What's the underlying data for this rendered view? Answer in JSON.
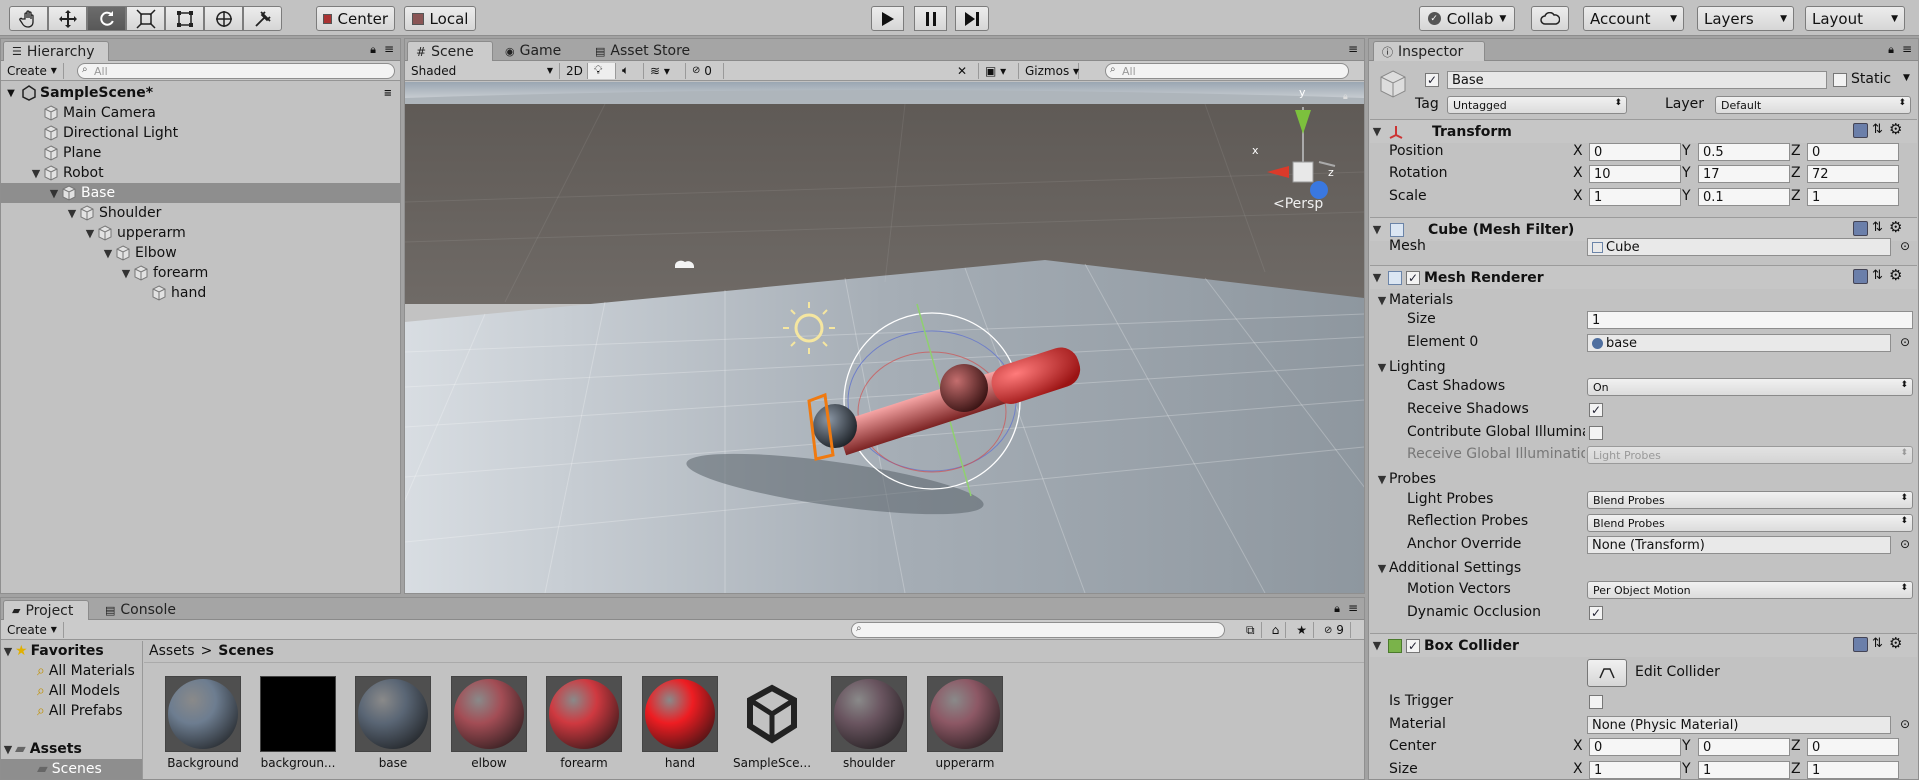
{
  "toolbar": {
    "center_label": "Center",
    "local_label": "Local",
    "collab_label": "Collab",
    "account_label": "Account",
    "layers_label": "Layers",
    "layout_label": "Layout"
  },
  "hierarchy": {
    "tab": "Hierarchy",
    "create": "Create",
    "search_placeholder": "All",
    "scene": "SampleScene*",
    "items": [
      "Main Camera",
      "Directional Light",
      "Plane",
      "Robot",
      "Base",
      "Shoulder",
      "upperarm",
      "Elbow",
      "forearm",
      "hand"
    ]
  },
  "scene": {
    "tabs": [
      "Scene",
      "Game",
      "Asset Store"
    ],
    "shading": "Shaded",
    "mode_2d": "2D",
    "hidden_count": "0",
    "gizmos": "Gizmos",
    "search_placeholder": "All",
    "persp": "Persp",
    "axis_x": "x",
    "axis_y": "y",
    "axis_z": "z"
  },
  "project": {
    "tabs": [
      "Project",
      "Console"
    ],
    "create": "Create",
    "favorites": "Favorites",
    "fav_items": [
      "All Materials",
      "All Models",
      "All Prefabs"
    ],
    "assets": "Assets",
    "scenes": "Scenes",
    "breadcrumb_root": "Assets",
    "breadcrumb_sep": ">",
    "breadcrumb_current": "Scenes",
    "visible_count": "9",
    "items": [
      {
        "name": "Background",
        "color": "#6d7d90"
      },
      {
        "name": "backgroun...",
        "color": "#000000"
      },
      {
        "name": "base",
        "color": "#5a6675"
      },
      {
        "name": "elbow",
        "color": "#a34d55"
      },
      {
        "name": "forearm",
        "color": "#cf3940"
      },
      {
        "name": "hand",
        "color": "#ee1d22"
      },
      {
        "name": "SampleSce...",
        "color": "unity"
      },
      {
        "name": "shoulder",
        "color": "#6a5560"
      },
      {
        "name": "upperarm",
        "color": "#8d5865"
      }
    ]
  },
  "inspector": {
    "tab": "Inspector",
    "object_name": "Base",
    "static_label": "Static",
    "tag_label": "Tag",
    "tag_value": "Untagged",
    "layer_label": "Layer",
    "layer_value": "Default",
    "transform": {
      "title": "Transform",
      "position_label": "Position",
      "rotation_label": "Rotation",
      "scale_label": "Scale",
      "x": "X",
      "y": "Y",
      "z": "Z",
      "position": [
        "0",
        "0.5",
        "0"
      ],
      "rotation": [
        "10",
        "17",
        "72"
      ],
      "scale": [
        "1",
        "0.1",
        "1"
      ]
    },
    "mesh_filter": {
      "title": "Cube (Mesh Filter)",
      "mesh_label": "Mesh",
      "mesh_value": "Cube"
    },
    "mesh_renderer": {
      "title": "Mesh Renderer",
      "materials": "Materials",
      "size_label": "Size",
      "size_value": "1",
      "element0_label": "Element 0",
      "element0_value": "base",
      "lighting": "Lighting",
      "cast_shadows_label": "Cast Shadows",
      "cast_shadows_value": "On",
      "receive_shadows_label": "Receive Shadows",
      "contribute_gi_label": "Contribute Global Illumina",
      "receive_gi_label": "Receive Global Illumination",
      "receive_gi_value": "Light Probes",
      "probes": "Probes",
      "light_probes_label": "Light Probes",
      "light_probes_value": "Blend Probes",
      "reflection_probes_label": "Reflection Probes",
      "reflection_probes_value": "Blend Probes",
      "anchor_override_label": "Anchor Override",
      "anchor_override_value": "None (Transform)",
      "additional": "Additional Settings",
      "motion_vectors_label": "Motion Vectors",
      "motion_vectors_value": "Per Object Motion",
      "dynamic_occlusion_label": "Dynamic Occlusion"
    },
    "box_collider": {
      "title": "Box Collider",
      "edit_collider": "Edit Collider",
      "is_trigger_label": "Is Trigger",
      "material_label": "Material",
      "material_value": "None (Physic Material)",
      "center_label": "Center",
      "size_label": "Size",
      "center": [
        "0",
        "0",
        "0"
      ],
      "size": [
        "1",
        "1",
        "1"
      ]
    }
  }
}
